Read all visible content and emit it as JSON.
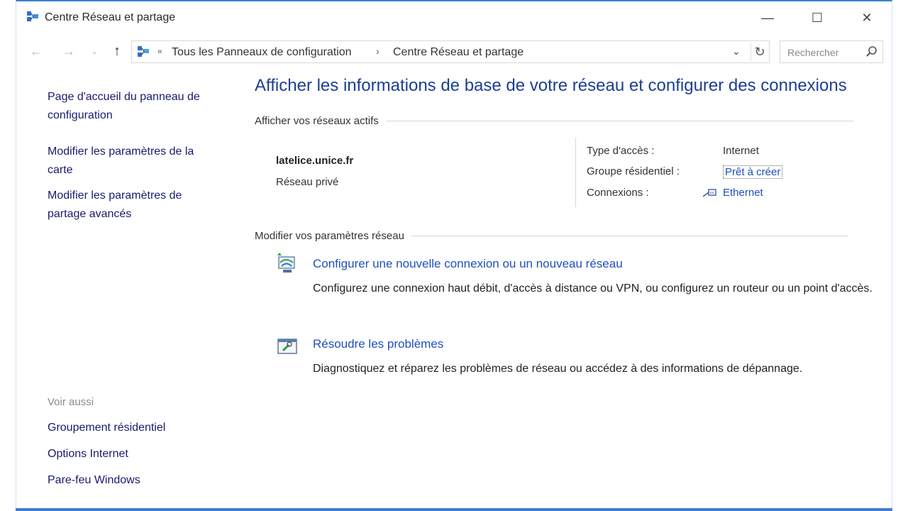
{
  "window": {
    "title": "Centre Réseau et partage"
  },
  "controls": {
    "minimize": "—",
    "maximize": "☐",
    "close": "✕"
  },
  "nav": {
    "back": "←",
    "forward": "→",
    "dropdown": "⌄",
    "up": "↑"
  },
  "address": {
    "separator": "«",
    "crumbs": [
      "Tous les Panneaux de configuration",
      "Centre Réseau et partage"
    ],
    "crumb_sep": "›",
    "dropdown": "⌄",
    "refresh": "↻"
  },
  "search": {
    "placeholder": "Rechercher"
  },
  "sidebar": {
    "links": [
      "Page d'accueil du panneau de configuration",
      "Modifier les paramètres de la carte",
      "Modifier les paramètres de partage avancés"
    ],
    "see_also_title": "Voir aussi",
    "see_also": [
      "Groupement résidentiel",
      "Options Internet",
      "Pare-feu Windows"
    ]
  },
  "main": {
    "title": "Afficher les informations de base de votre réseau et configurer des connexions",
    "active_networks_header": "Afficher vos réseaux actifs",
    "network": {
      "name": "latelice.unice.fr",
      "type": "Réseau privé",
      "access_label": "Type d'accès :",
      "access_value": "Internet",
      "homegroup_label": "Groupe résidentiel :",
      "homegroup_value": "Prêt à créer",
      "connections_label": "Connexions :",
      "connections_value": "Ethernet"
    },
    "change_settings_header": "Modifier vos paramètres réseau",
    "tasks": [
      {
        "title": "Configurer une nouvelle connexion ou un nouveau réseau",
        "desc": "Configurez une connexion haut débit, d'accès à distance ou VPN, ou configurez un routeur ou un point d'accès."
      },
      {
        "title": "Résoudre les problèmes",
        "desc": "Diagnostiquez et réparez les problèmes de réseau ou accédez à des informations de dépannage."
      }
    ]
  },
  "colors": {
    "accent_border": "#3b7fd1",
    "link": "#1f4fbf",
    "title": "#1c3f94"
  }
}
